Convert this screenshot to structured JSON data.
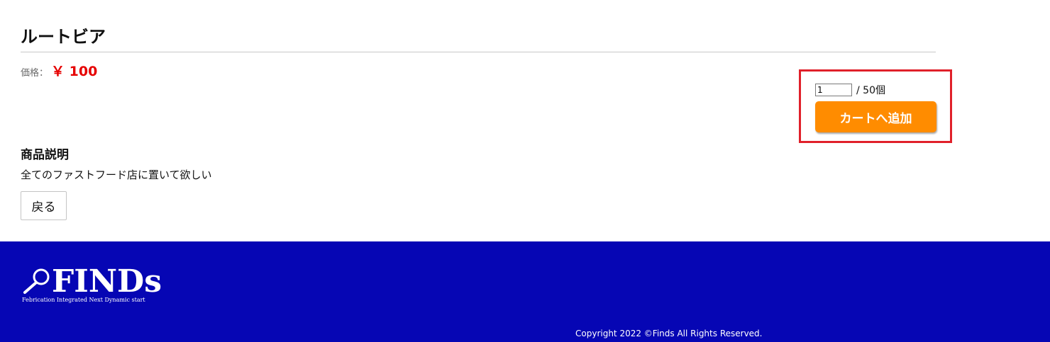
{
  "product": {
    "title": "ルートビア",
    "price_label": "価格：",
    "price_value": "￥ 100"
  },
  "cart": {
    "quantity_value": "1",
    "stock_text": "/ 50個",
    "add_button_label": "カートへ追加"
  },
  "description": {
    "heading": "商品説明",
    "text": "全てのファストフード店に置いて欲しい"
  },
  "back_button_label": "戻る",
  "footer": {
    "logo_text": "FINDs",
    "logo_tagline": "Febrication Integrated Next Dynamic start",
    "copyright": "Copyright 2022 ©Finds All Rights Reserved."
  },
  "colors": {
    "price": "#e60000",
    "add_button": "#ff8c00",
    "highlight_box": "#e0202a",
    "footer_bg": "#0606b4"
  },
  "icons": {
    "logo_icon": "magnifier-icon"
  }
}
